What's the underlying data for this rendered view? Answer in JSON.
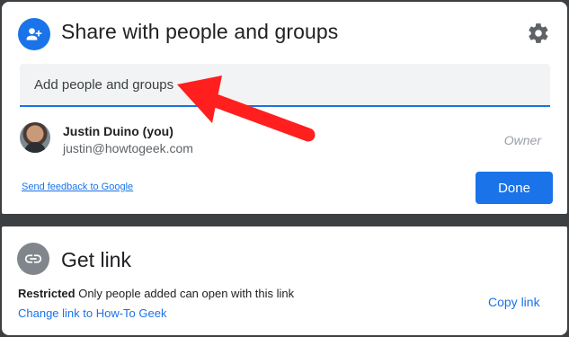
{
  "share_dialog": {
    "title": "Share with people and groups",
    "add_input": {
      "value": "",
      "placeholder": "Add people and groups"
    },
    "person": {
      "name": "Justin Duino (you)",
      "email": "justin@howtogeek.com",
      "role": "Owner"
    },
    "feedback_link": "Send feedback to Google",
    "done_button": "Done",
    "icons": {
      "header": "add-person-icon",
      "settings": "gear-icon"
    }
  },
  "link_panel": {
    "title": "Get link",
    "restriction_label": "Restricted",
    "restriction_description": "Only people added can open with this link",
    "change_link": "Change link to How-To Geek",
    "copy_link": "Copy link",
    "icon": "link-icon"
  },
  "colors": {
    "accent": "#1a73e8",
    "annotation_arrow": "#ff1f1f",
    "link_icon_bg": "#80868b"
  }
}
